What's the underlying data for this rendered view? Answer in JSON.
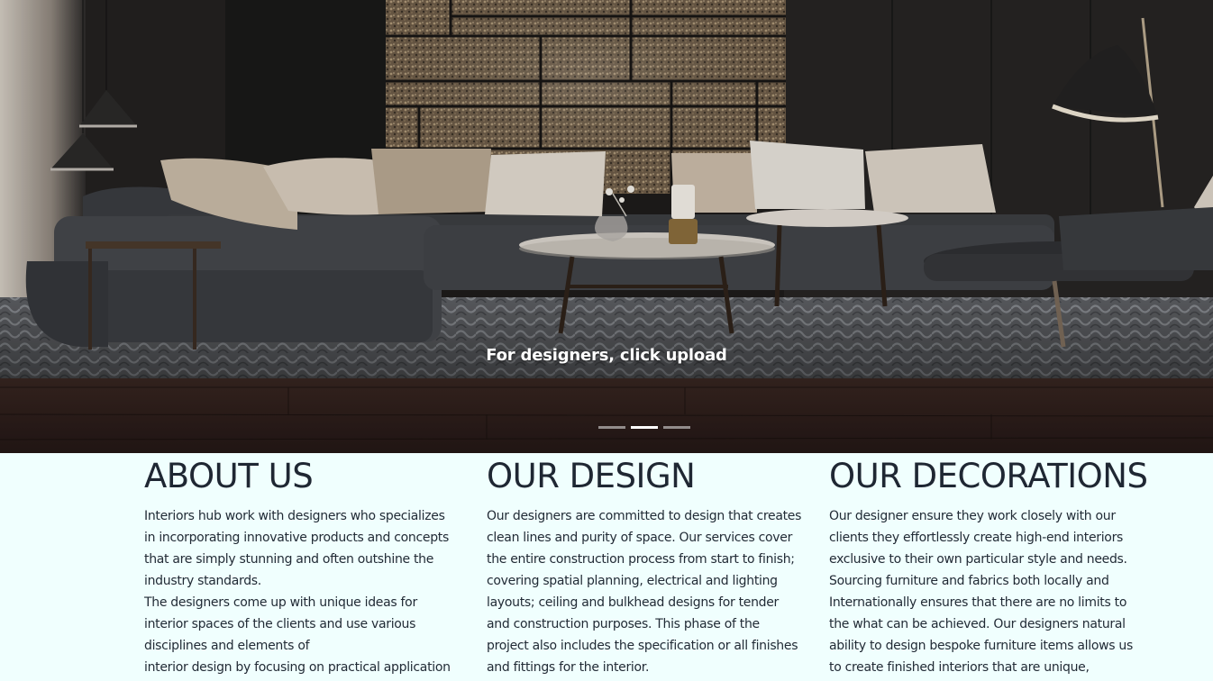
{
  "carousel": {
    "caption": "For designers, click upload",
    "indicators": [
      {
        "label": "Slide 1",
        "active": false
      },
      {
        "label": "Slide 2",
        "active": true
      },
      {
        "label": "Slide 3",
        "active": false
      }
    ]
  },
  "sections": {
    "about": {
      "title": "ABOUT US",
      "lines": [
        "Interiors hub work with designers who specializes",
        "in incorporating innovative products and concepts",
        "that are simply stunning and often outshine the",
        "industry standards.",
        "The designers come up with unique ideas for",
        "interior spaces of the clients and use various",
        "disciplines and elements of",
        "interior design by focusing on practical application"
      ]
    },
    "design": {
      "title": "OUR DESIGN",
      "lines": [
        "Our designers are committed to design that creates",
        "clean lines and purity of space. Our services cover",
        "the entire construction process from start to finish;",
        "covering spatial planning, electrical and lighting",
        "layouts; ceiling and bulkhead designs for tender",
        "and construction purposes. This phase of the",
        "project also includes the specification or all finishes",
        "and fittings for the interior."
      ]
    },
    "decorations": {
      "title": "OUR DECORATIONS",
      "lines": [
        "Our designer ensure they work closely with our",
        "clients they effortlessly create high-end interiors",
        "exclusive to their own particular style and needs.",
        "Sourcing furniture and fabrics both locally and",
        "Internationally ensures that there are no limits to",
        "the what can be achieved. Our designers natural",
        "ability to design bespoke furniture items allows us",
        "to create finished interiors that are unique,"
      ]
    }
  },
  "colors": {
    "page_background": "#f0fffe",
    "heading_text": "#1f2733",
    "body_text": "#222b36",
    "caption_text": "#ffffff"
  }
}
